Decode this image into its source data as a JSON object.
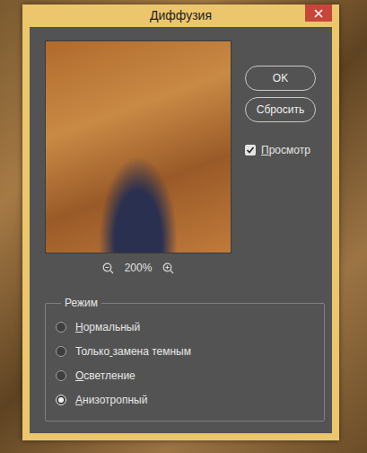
{
  "window": {
    "title": "Диффузия"
  },
  "preview": {
    "zoom": "200%"
  },
  "buttons": [
    {
      "label": "OK"
    },
    {
      "label": "Сбросить"
    }
  ],
  "preview_checkbox": {
    "label": "Просмотр",
    "checked": true,
    "accel": 0
  },
  "mode": {
    "title": "Режим",
    "options": [
      {
        "label": "Нормальный",
        "selected": false,
        "accel": 0
      },
      {
        "label": "Только замена темным",
        "selected": false,
        "accel": 6
      },
      {
        "label": "Осветление",
        "selected": false,
        "accel": 0
      },
      {
        "label": "Анизотропный",
        "selected": true,
        "accel": 0
      }
    ]
  }
}
